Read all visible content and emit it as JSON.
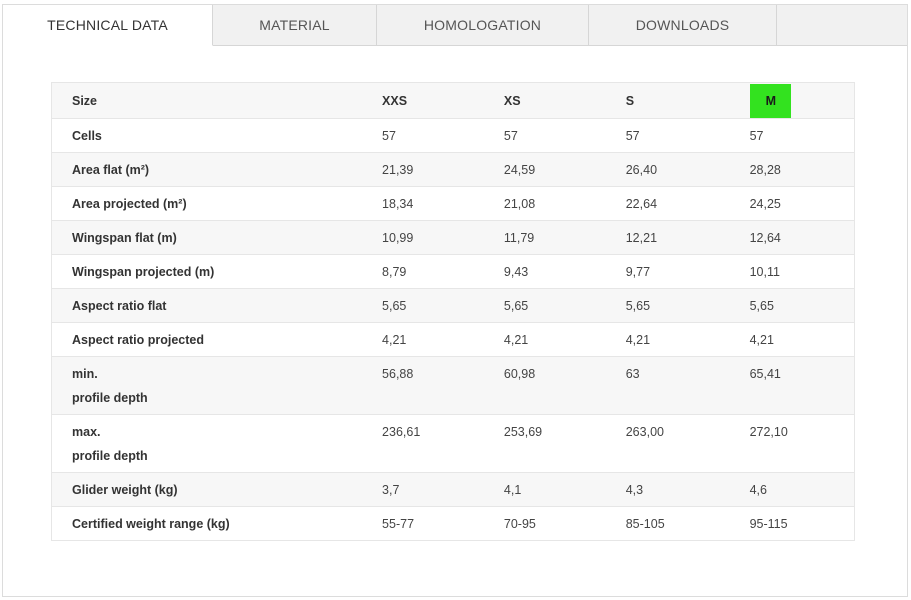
{
  "tabs": [
    {
      "label": "TECHNICAL DATA",
      "active": true
    },
    {
      "label": "MATERIAL",
      "active": false
    },
    {
      "label": "HOMOLOGATION",
      "active": false
    },
    {
      "label": "DOWNLOADS",
      "active": false
    }
  ],
  "table": {
    "header": {
      "label": "Size",
      "sizes": [
        "XXS",
        "XS",
        "S",
        "M"
      ],
      "highlighted_size": "M"
    },
    "rows": [
      {
        "label": "Cells",
        "values": [
          "57",
          "57",
          "57",
          "57"
        ]
      },
      {
        "label": "Area flat (m²)",
        "values": [
          "21,39",
          "24,59",
          "26,40",
          "28,28"
        ]
      },
      {
        "label": "Area projected (m²)",
        "values": [
          "18,34",
          "21,08",
          "22,64",
          "24,25"
        ]
      },
      {
        "label": "Wingspan flat (m)",
        "values": [
          "10,99",
          "11,79",
          "12,21",
          "12,64"
        ]
      },
      {
        "label": "Wingspan projected (m)",
        "values": [
          "8,79",
          "9,43",
          "9,77",
          "10,11"
        ]
      },
      {
        "label": "Aspect ratio flat",
        "values": [
          "5,65",
          "5,65",
          "5,65",
          "5,65"
        ]
      },
      {
        "label": "Aspect ratio projected",
        "values": [
          "4,21",
          "4,21",
          "4,21",
          "4,21"
        ]
      },
      {
        "label_line1": "min.",
        "label_line2": "profile depth",
        "values": [
          "56,88",
          "60,98",
          "63",
          "65,41"
        ]
      },
      {
        "label_line1": "max.",
        "label_line2": "profile depth",
        "values": [
          "236,61",
          "253,69",
          "263,00",
          "272,10"
        ]
      },
      {
        "label": "Glider weight (kg)",
        "values": [
          "3,7",
          "4,1",
          "4,3",
          "4,6"
        ]
      },
      {
        "label": "Certified weight range (kg)",
        "values": [
          "55-77",
          "70-95",
          "85-105",
          "95-115"
        ]
      }
    ]
  },
  "colors": {
    "highlight": "#33e21f",
    "stripe": "#f7f7f7",
    "border": "#e6e6e6"
  }
}
